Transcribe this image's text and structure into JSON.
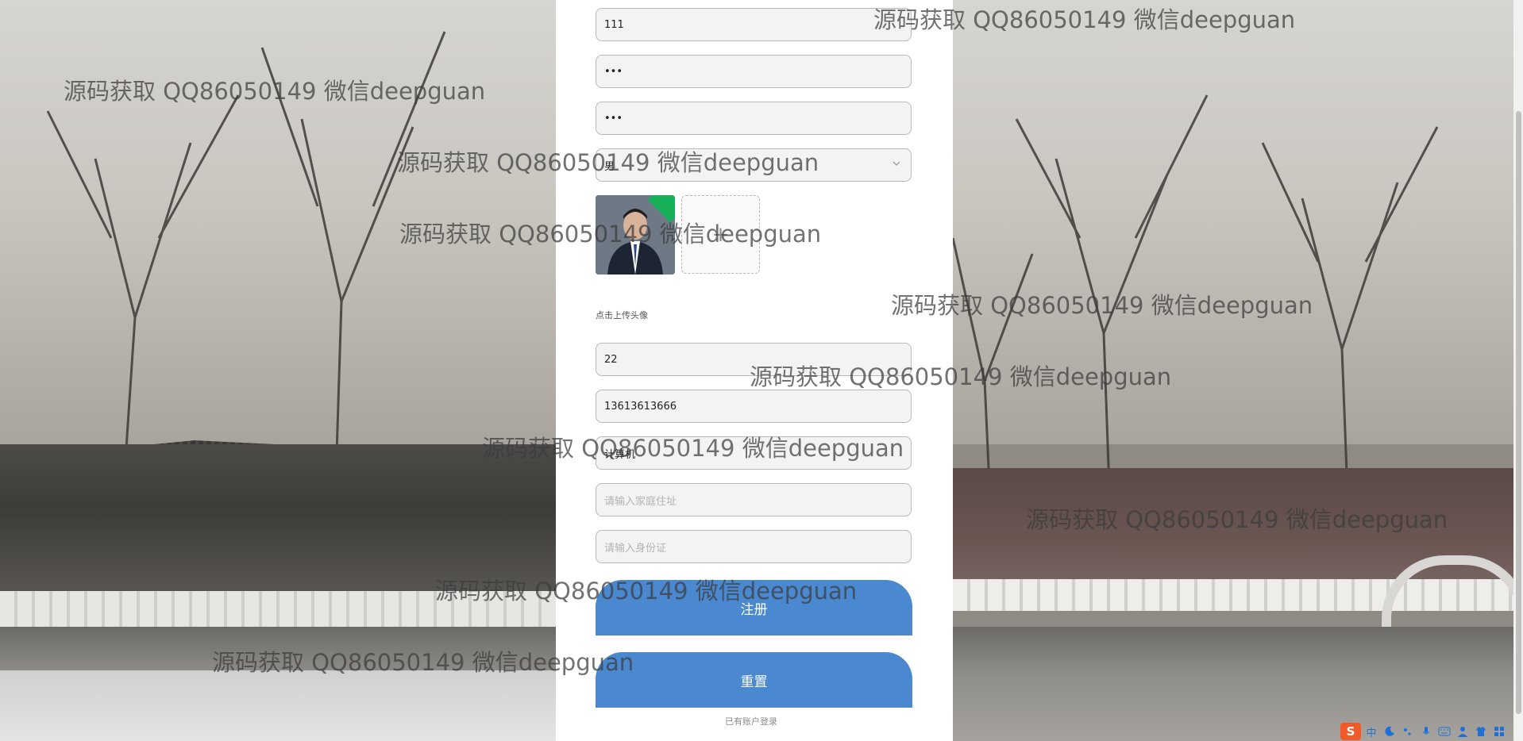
{
  "form": {
    "username_value": "111",
    "password_value": "•••",
    "confirm_password_value": "•••",
    "gender_selected": "男",
    "avatar_hint": "点击上传头像",
    "upload_plus": "+",
    "age_value": "22",
    "phone_value": "13613613666",
    "major_value": "计算机",
    "address_placeholder": "请输入家庭住址",
    "idcard_placeholder": "请输入身份证",
    "register_label": "注册",
    "reset_label": "重置",
    "login_link": "已有账户登录"
  },
  "watermark_text": "源码获取 QQ86050149 微信deepguan",
  "tray": {
    "ime_logo": "S",
    "ime_lang": "中"
  },
  "colors": {
    "button": "#4a88cf",
    "avatar_badge": "#17b15a",
    "panel": "#ffffff"
  }
}
